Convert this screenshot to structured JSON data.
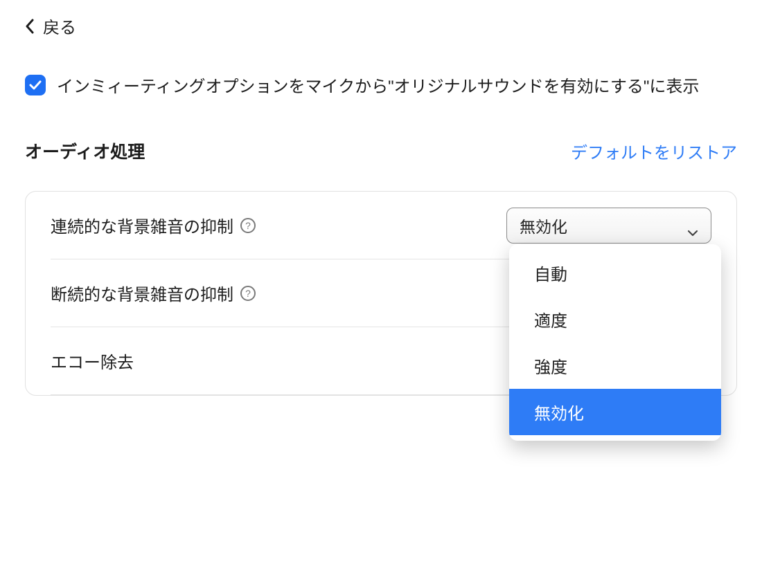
{
  "back": {
    "label": "戻る"
  },
  "original_sound_checkbox": {
    "checked": true,
    "label": "インミィーティングオプションをマイクから\"オリジナルサウンドを有効にする\"に表示"
  },
  "section": {
    "title": "オーディオ処理",
    "restore_label": "デフォルトをリストア"
  },
  "settings": {
    "row1_label": "連続的な背景雑音の抑制",
    "row2_label": "断続的な背景雑音の抑制",
    "row3_label": "エコー除去"
  },
  "select": {
    "selected": "無効化",
    "options": [
      "自動",
      "適度",
      "強度",
      "無効化"
    ]
  }
}
